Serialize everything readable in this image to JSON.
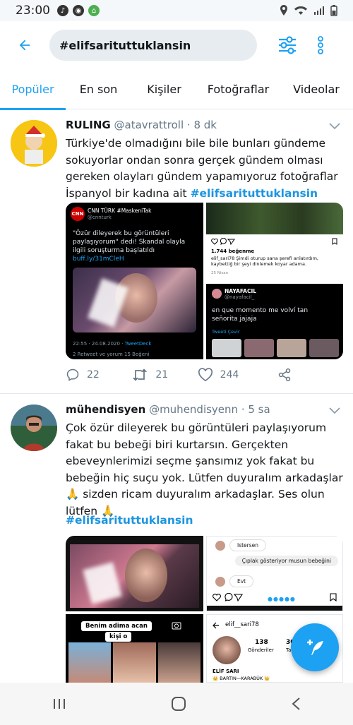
{
  "status": {
    "time": "23:00"
  },
  "search": {
    "query": "#elifsarituttuklansin"
  },
  "tabs": [
    "Popüler",
    "En son",
    "Kişiler",
    "Fotoğraflar",
    "Videolar"
  ],
  "tweet1": {
    "name": "RULING",
    "handle": "@atavrattroll · 8 dk",
    "text": "Türkiye'de olmadığını bile bile bunları gündeme sokuyorlar ondan sonra gerçek gündem olması gereken olayları gündem yapamıyoruz fotoğraflar İspanyol bir kadına ait",
    "hashtag": "#elifsarituttuklansin",
    "replies": "22",
    "retweets": "21",
    "likes": "244",
    "media": {
      "p1_user": "CNN TÜRK #MaskeniTak",
      "p1_handle": "@cnnturk",
      "p1_text": "\"Özür dileyerek bu görüntüleri paylaşıyorum\" dedi! Skandal olayla ilgili soruşturma başlatıldı",
      "p1_link": "buff.ly/31mCleH",
      "p1_time": "22:55 · 24.08.2020 ·",
      "p1_source": "TweetDeck",
      "p1_stats": "2 Retweet ve yorum  15 Beğeni",
      "p2_likes": "1.744 beğenme",
      "p2_caption": "elif_sari78 Şimdi oturup sana şerefi anlatırdım, kaybettiğ bir şeyi dinlemek koyar adama.",
      "p2_time": "25 Nisan",
      "p3_user": "NAYAFACIL",
      "p3_handle": "@nayafacil_",
      "p3_text": "en que momento me volví tan señorita jajaja",
      "p3_link": "Tweeti Çevir"
    }
  },
  "tweet2": {
    "name": "mühendisyen",
    "handle": "@muhendisyenn · 5 sa",
    "text": "Çok özür dileyerek bu görüntüleri paylaşıyorum fakat bu bebeği biri kurtarsın. Gerçekten ebeveynlerimizi seçme şansımız yok fakat bu bebeğin hiç suçu yok. Lütfen duyuralım arkadaşlar 🙏  sizden ricam duyuralım arkadaşlar. Ses olun lütfen 🙏",
    "hashtag": "#elifsarituttuklansin",
    "media": {
      "chat1": "Istersen",
      "chat2": "Çıplak gösteriyor musun bebeğini",
      "chat3": "Evt",
      "story_text1": "Benim adima acan",
      "story_text2": "kişi o",
      "profile_user": "elif__sari78",
      "profile_posts": "138",
      "profile_posts_label": "Gönderiler",
      "profile_followers": "30",
      "profile_followers_label": "Tak",
      "profile_name": "ELİF SARI",
      "profile_loc": "👑 BARTIN—KARABÜK 👑"
    }
  }
}
